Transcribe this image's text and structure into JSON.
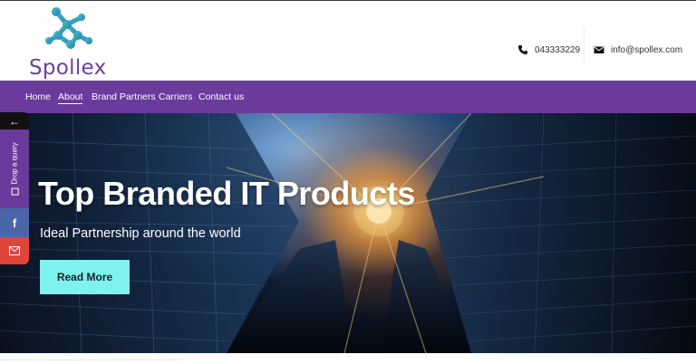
{
  "brand": {
    "logo_text": "Spollex",
    "logo_icon": "molecule-network-icon"
  },
  "header": {
    "phone": "043333229",
    "phone_icon": "phone-icon",
    "email": "info@spollex.com",
    "email_icon": "envelope-icon"
  },
  "nav": {
    "items": [
      {
        "label": "Home",
        "active": false
      },
      {
        "label": "About",
        "active": true
      },
      {
        "label": "Brand Partners",
        "active": false
      },
      {
        "label": "Carriers",
        "active": false
      },
      {
        "label": "Contact us",
        "active": false
      }
    ]
  },
  "hero": {
    "title": "Top Branded IT Products",
    "subtitle": "Ideal Partnership around the world",
    "button_label": "Read More"
  },
  "side_panel": {
    "arrow": "←",
    "query_label": "Drop a query",
    "facebook": "f",
    "mail_icon": "envelope-icon"
  },
  "colors": {
    "brand_purple": "#6a3a9c",
    "logo_teal": "#2fb6b8",
    "button_cyan": "#7ef2ee",
    "facebook_blue": "#4a65a8",
    "mail_red": "#e0453a"
  }
}
